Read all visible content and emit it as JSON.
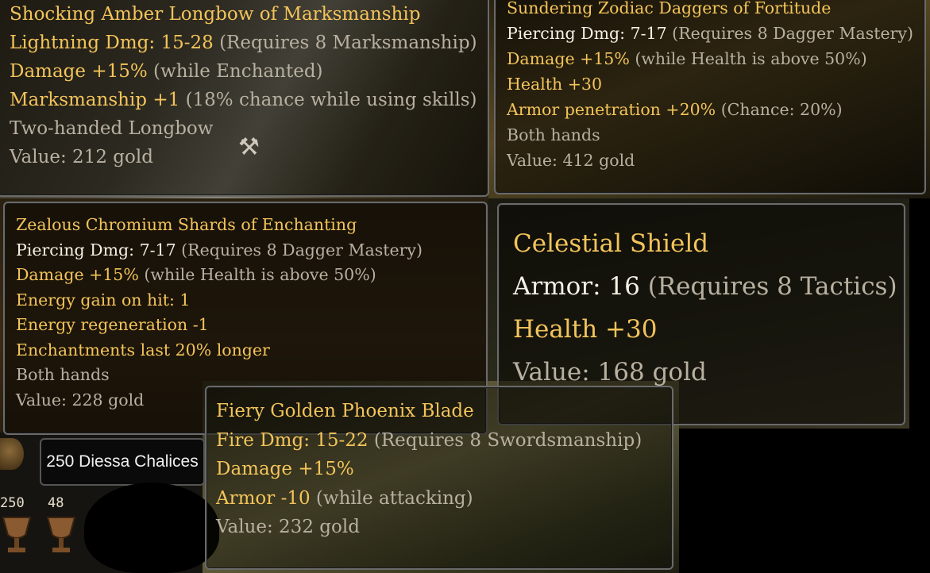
{
  "tooltips": [
    {
      "title": "Shocking Amber Longbow of Marksmanship",
      "lines": [
        {
          "main": "Lightning Dmg: 15-28",
          "note": "(Requires 8 Marksmanship)"
        },
        {
          "main": "Damage +15%",
          "note": "(while Enchanted)"
        },
        {
          "main": "Marksmanship +1",
          "note": "(18% chance while using skills)"
        },
        {
          "main": "Two-handed Longbow",
          "note": ""
        },
        {
          "main": "Value: 212 gold",
          "note": ""
        }
      ]
    },
    {
      "title": "Sundering Zodiac Daggers of Fortitude",
      "lines": [
        {
          "main": "Piercing Dmg: 7-17",
          "note": "(Requires 8 Dagger Mastery)"
        },
        {
          "main": "Damage +15%",
          "note": "(while Health is above 50%)"
        },
        {
          "main": "Health +30",
          "note": ""
        },
        {
          "main": "Armor penetration +20%",
          "note": "(Chance: 20%)"
        },
        {
          "main": "Both hands",
          "note": ""
        },
        {
          "main": "Value: 412 gold",
          "note": ""
        }
      ]
    },
    {
      "title": "Zealous Chromium Shards of Enchanting",
      "lines": [
        {
          "main": "Piercing Dmg: 7-17",
          "note": "(Requires 8 Dagger Mastery)"
        },
        {
          "main": "Damage +15%",
          "note": "(while Health is above 50%)"
        },
        {
          "main": "Energy gain on hit: 1",
          "note": ""
        },
        {
          "main": "Energy regeneration -1",
          "note": ""
        },
        {
          "main": "Enchantments last 20% longer",
          "note": ""
        },
        {
          "main": "Both hands",
          "note": ""
        },
        {
          "main": "Value: 228 gold",
          "note": ""
        }
      ]
    },
    {
      "title": "Celestial Shield",
      "lines": [
        {
          "main": "Armor: 16",
          "note": "(Requires 8 Tactics)"
        },
        {
          "main": "Health +30",
          "note": ""
        },
        {
          "main": "Value: 168 gold",
          "note": ""
        }
      ]
    },
    {
      "title": "Fiery Golden Phoenix Blade",
      "lines": [
        {
          "main": "Fire Dmg: 15-22",
          "note": "(Requires 8 Swordsmanship)"
        },
        {
          "main": "Damage +15%",
          "note": ""
        },
        {
          "main": "Armor -10",
          "note": "(while attacking)"
        },
        {
          "main": "Value: 232 gold",
          "note": ""
        }
      ]
    }
  ],
  "inventory": {
    "item_label": "250 Diessa Chalices",
    "stacks": [
      "250",
      "48"
    ]
  },
  "colors": {
    "title_gold": "#f3c45a",
    "stat_white": "#f4f0e4",
    "note_grey": "#b8b0a0"
  },
  "icons": [
    "axe-icon",
    "chalice-icon",
    "sack-icon"
  ]
}
